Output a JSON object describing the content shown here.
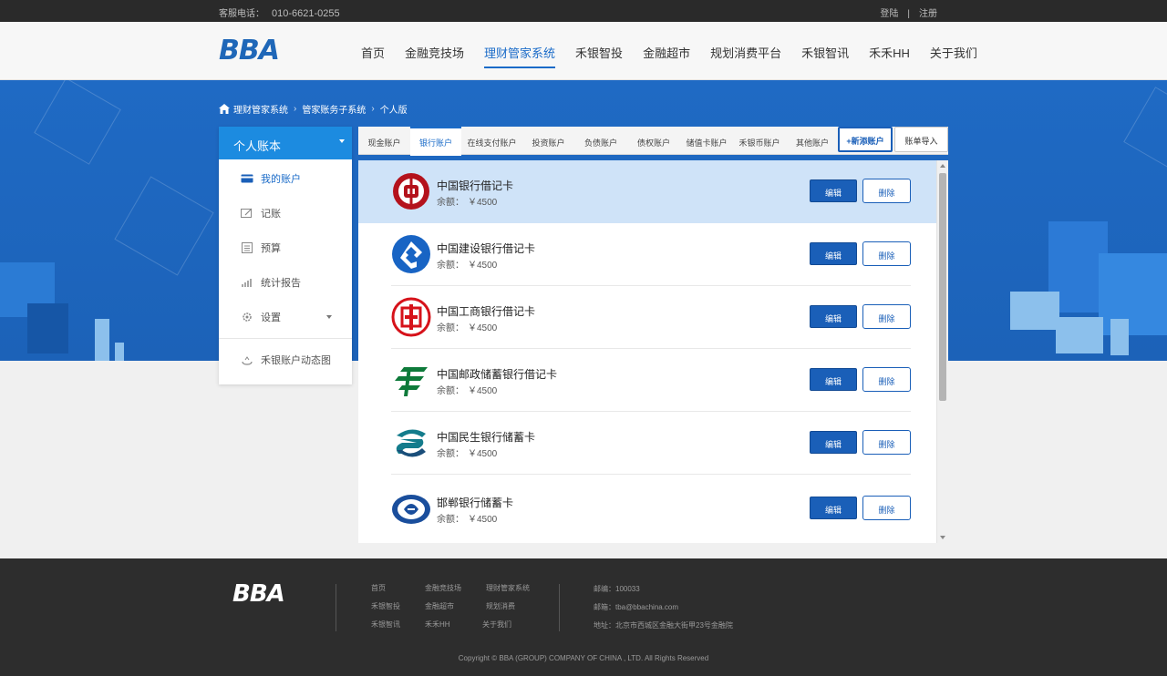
{
  "topbar": {
    "phone_label": "客服电话：",
    "phone_number": "010-6621-0255",
    "login": "登陆",
    "separator": "|",
    "register": "注册"
  },
  "header": {
    "logo": "BBA",
    "nav": [
      {
        "label": "首页"
      },
      {
        "label": "金融竞技场"
      },
      {
        "label": "理财管家系统",
        "active": true
      },
      {
        "label": "禾银智投"
      },
      {
        "label": "金融超市"
      },
      {
        "label": "规划消费平台"
      },
      {
        "label": "禾银智讯"
      },
      {
        "label": "禾禾HH"
      },
      {
        "label": "关于我们"
      }
    ]
  },
  "breadcrumb": {
    "items": [
      "理财管家系统",
      "管家账务子系统",
      "个人版"
    ],
    "arrow": "›"
  },
  "sidebar": {
    "title": "个人账本",
    "items": [
      {
        "label": "我的账户",
        "icon": "card-icon",
        "active": true
      },
      {
        "label": "记账",
        "icon": "edit-icon"
      },
      {
        "label": "预算",
        "icon": "calculator-icon"
      },
      {
        "label": "统计报告",
        "icon": "bar-chart-icon"
      },
      {
        "label": "设置",
        "icon": "gear-icon"
      }
    ],
    "extra": {
      "label": "禾银账户动态图",
      "icon": "cloud-icon"
    }
  },
  "tabs": {
    "items": [
      "现金账户",
      "银行账户",
      "在线支付账户",
      "投资账户",
      "负债账户",
      "债权账户",
      "储值卡账户",
      "禾银币账户",
      "其他账户"
    ],
    "active_index": 1,
    "add_button": "+新添账户",
    "import_button": "账单导入"
  },
  "accounts": {
    "balance_label": "余额：",
    "edit_label": "编辑",
    "delete_label": "删除",
    "rows": [
      {
        "name": "中国银行借记卡",
        "balance": "￥4500",
        "icon": "bank-of-china-logo-icon",
        "color": "#b4121c"
      },
      {
        "name": "中国建设银行借记卡",
        "balance": "￥4500",
        "icon": "ccb-logo-icon",
        "color": "#1864c4"
      },
      {
        "name": "中国工商银行借记卡",
        "balance": "￥4500",
        "icon": "icbc-logo-icon",
        "color": "#d6121a"
      },
      {
        "name": "中国邮政储蓄银行借记卡",
        "balance": "￥4500",
        "icon": "psbc-logo-icon",
        "color": "#0e7a3a"
      },
      {
        "name": "中国民生银行储蓄卡",
        "balance": "￥4500",
        "icon": "cmbc-logo-icon",
        "color": "#147c8c"
      },
      {
        "name": "邯郸银行储蓄卡",
        "balance": "￥4500",
        "icon": "handan-bank-logo-icon",
        "color": "#1a4e9c"
      }
    ]
  },
  "footer": {
    "logo": "BBA",
    "links": [
      [
        "首页",
        "金融竞技场",
        "理财管家系统"
      ],
      [
        "禾银智投",
        "金融超市",
        "规划消费"
      ],
      [
        "禾银智讯",
        "禾禾HH",
        "关于我们"
      ]
    ],
    "info": [
      "邮编：100033",
      "邮箱：tba@bbachina.com",
      "地址：北京市西城区金融大街甲23号金融院"
    ],
    "copyright": "Copyright © BBA (GROUP) COMPANY OF CHINA , LTD. All Rights Reserved"
  },
  "colors": {
    "brand_blue": "#1a5fb8",
    "banner_blue": "#1f6ac4",
    "sidebar_head": "#1c8be0",
    "highlight_row": "#cfe3f8"
  }
}
